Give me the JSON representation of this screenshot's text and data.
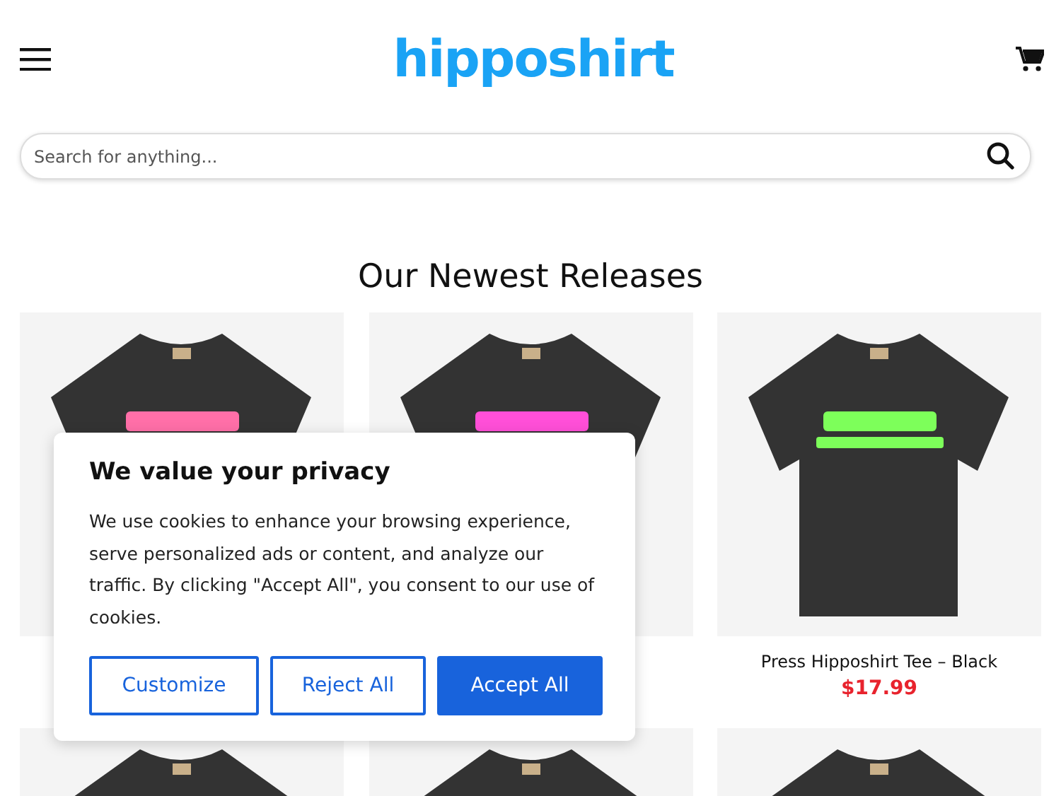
{
  "header": {
    "logo": "hipposhirt"
  },
  "search": {
    "placeholder": "Search for anything..."
  },
  "section_title": "Our Newest Releases",
  "products": [
    {
      "kind": "covered"
    },
    {
      "kind": "covered"
    },
    {
      "kind": "listed",
      "title": "Press Hipposhirt Tee – Black",
      "price": "$17.99"
    },
    {
      "kind": "cut"
    },
    {
      "kind": "cut"
    },
    {
      "kind": "cut"
    }
  ],
  "cookie_banner": {
    "title": "We value your privacy",
    "text": "We use cookies to enhance your browsing experience, serve personalized ads or content, and analyze our traffic. By clicking \"Accept All\", you consent to our use of cookies.",
    "buttons": [
      {
        "label": "Customize",
        "kind": "outline"
      },
      {
        "label": "Reject All",
        "kind": "outline"
      },
      {
        "label": "Accept All",
        "kind": "primary"
      }
    ]
  }
}
